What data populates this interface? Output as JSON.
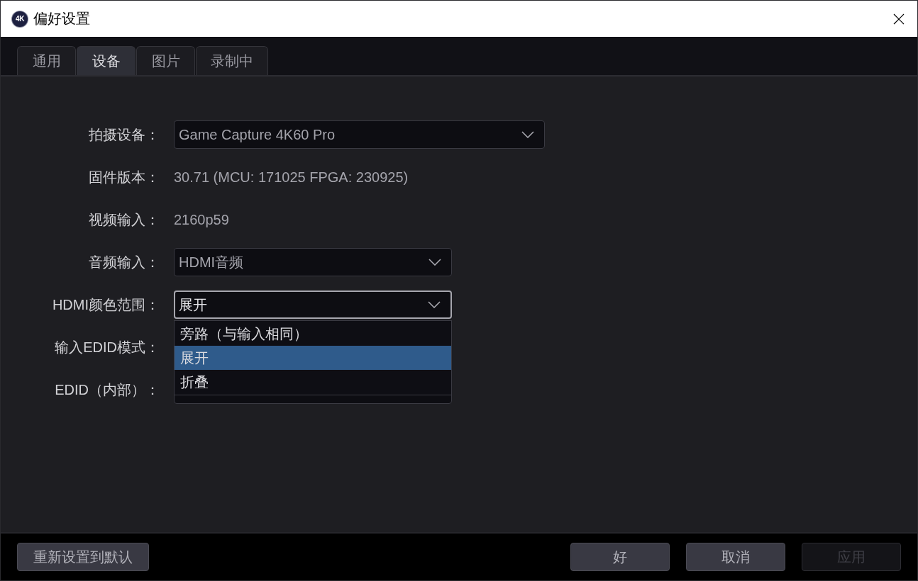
{
  "window": {
    "title": "偏好设置",
    "logo": "4K"
  },
  "tabs": [
    {
      "label": "通用",
      "selected": false
    },
    {
      "label": "设备",
      "selected": true
    },
    {
      "label": "图片",
      "selected": false
    },
    {
      "label": "录制中",
      "selected": false
    }
  ],
  "settings": [
    {
      "label": "拍摄设备：",
      "kind": "wide_select",
      "value": "Game Capture 4K60 Pro",
      "open": false
    },
    {
      "label": "固件版本：",
      "kind": "text",
      "value": "30.71 (MCU: 171025 FPGA: 230925)"
    },
    {
      "label": "视频输入：",
      "kind": "text",
      "value": "2160p59"
    },
    {
      "label": "音频输入：",
      "kind": "select",
      "value": "HDMI音频",
      "open": false
    },
    {
      "label": "HDMI颜色范围：",
      "kind": "select",
      "value": "展开",
      "open": true,
      "options": [
        {
          "label": "旁路（与输入相同）",
          "selected": false
        },
        {
          "label": "展开",
          "selected": true
        },
        {
          "label": "折叠",
          "selected": false
        }
      ]
    },
    {
      "label": "输入EDID模式：",
      "kind": "covered"
    },
    {
      "label": "EDID（内部）：",
      "kind": "select",
      "open": false
    }
  ],
  "footer": {
    "left_buttons": [
      {
        "label": "重新设置到默认",
        "disabled": false
      }
    ],
    "right_buttons": [
      {
        "label": "好",
        "disabled": false
      },
      {
        "label": "取消",
        "disabled": false
      },
      {
        "label": "应用",
        "disabled": true
      }
    ]
  }
}
